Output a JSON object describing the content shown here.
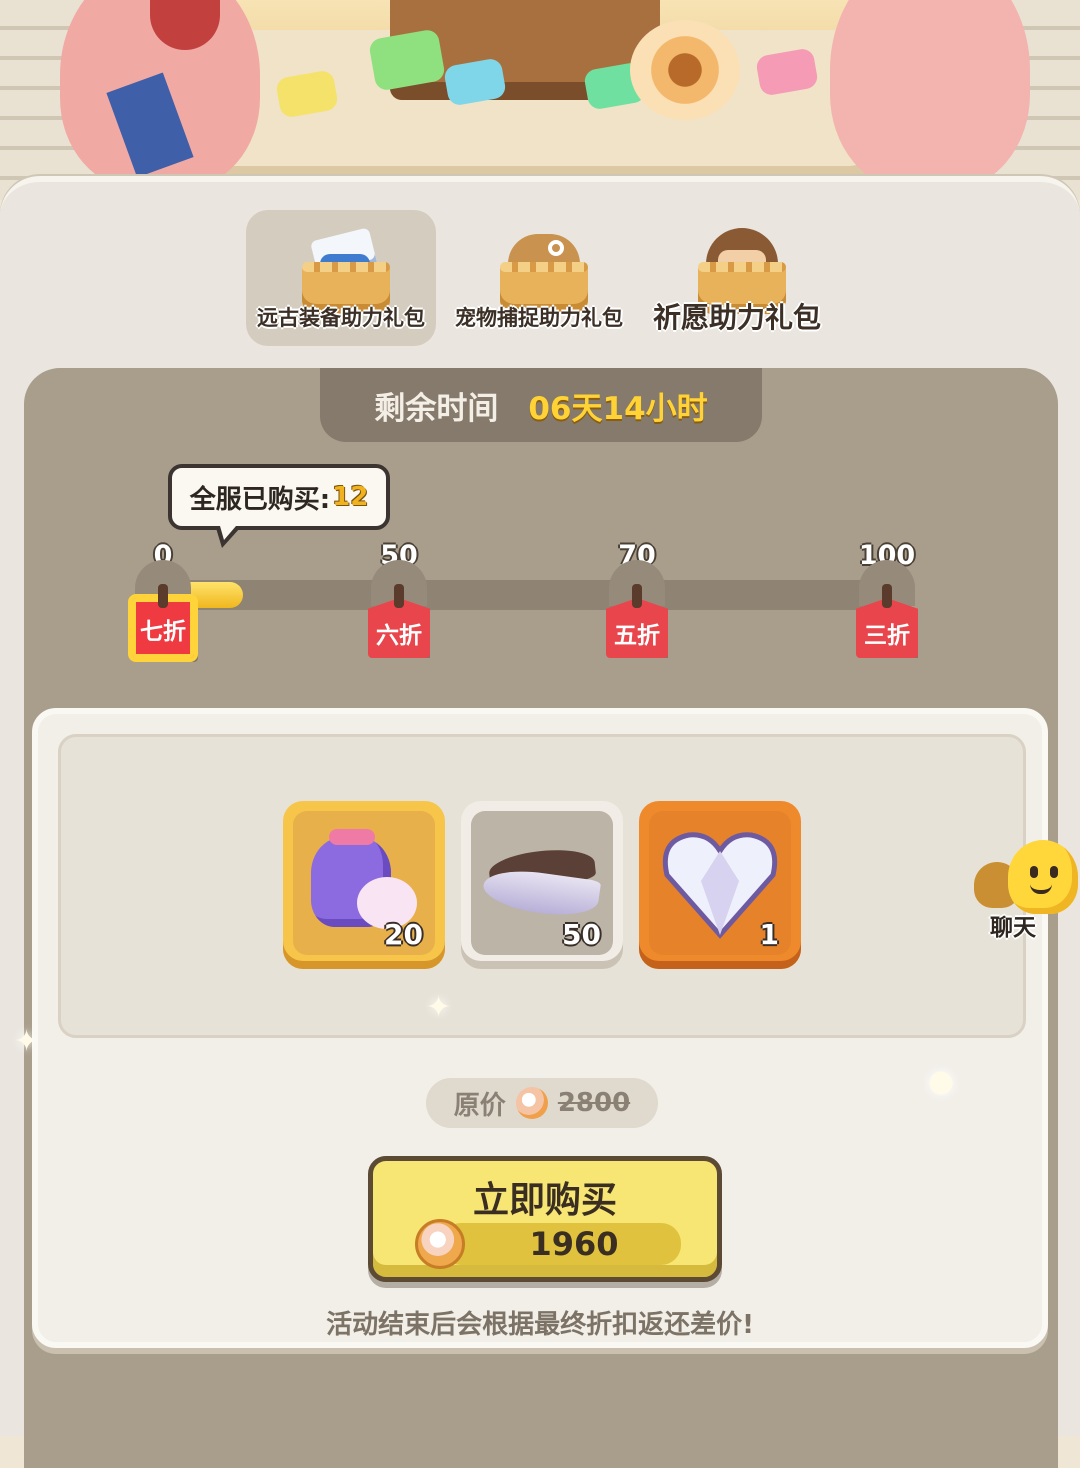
{
  "tabs": [
    {
      "label": "远古装备助力礼包",
      "active": true,
      "icon": "equipment-chest-icon"
    },
    {
      "label": "宠物捕捉助力礼包",
      "active": false,
      "icon": "pet-capture-icon"
    },
    {
      "label": "祈愿助力礼包",
      "active": false,
      "icon": "wish-character-icon"
    }
  ],
  "timer": {
    "label": "剩余时间",
    "value": "06天14小时"
  },
  "progress": {
    "purchased_label": "全服已购买:",
    "purchased_count": "12",
    "max": 100,
    "current": 12,
    "milestones": [
      {
        "count": "0",
        "discount": "七折",
        "value": 0,
        "active": true
      },
      {
        "count": "50",
        "discount": "六折",
        "value": 50,
        "active": false
      },
      {
        "count": "70",
        "discount": "五折",
        "value": 70,
        "active": false
      },
      {
        "count": "100",
        "discount": "三折",
        "value": 100,
        "active": false
      }
    ]
  },
  "rewards": [
    {
      "name": "pet-bag-icon",
      "count": "20",
      "rarity": "gold"
    },
    {
      "name": "feather-icon",
      "count": "50",
      "rarity": "grey"
    },
    {
      "name": "crystal-heart-icon",
      "count": "1",
      "rarity": "orange"
    }
  ],
  "price": {
    "original_label": "原价",
    "original_value": "2800",
    "buy_label": "立即购买",
    "buy_cost": "1960"
  },
  "note": "活动结束后会根据最终折扣返还差价!",
  "chat": {
    "label": "聊天"
  },
  "colors": {
    "accent_yellow": "#ffd335",
    "discount_red": "#e8464c",
    "panel_bg": "#eae6df"
  }
}
